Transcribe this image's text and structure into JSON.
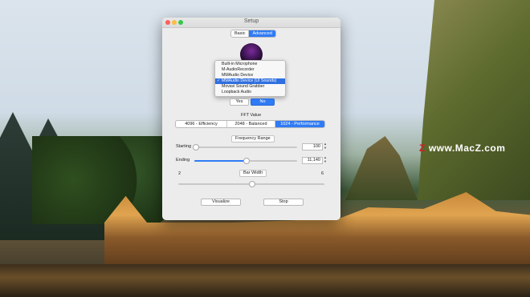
{
  "window": {
    "title": "Setup"
  },
  "tabs": [
    {
      "label": "Basic",
      "selected": false
    },
    {
      "label": "Advanced",
      "selected": true
    }
  ],
  "input_menu": {
    "items": [
      {
        "label": "Built-in Microphone",
        "selected": false
      },
      {
        "label": "M-AudioRecorder",
        "selected": false
      },
      {
        "label": "MMAudio Device",
        "selected": false
      },
      {
        "label": "MMAudio Device (UI Sounds)",
        "selected": true
      },
      {
        "label": "Movavi Sound Grabber",
        "selected": false
      },
      {
        "label": "Loopback Audio",
        "selected": false
      }
    ]
  },
  "yes_no": {
    "yes": "Yes",
    "no": "No",
    "selected": "No"
  },
  "fft": {
    "label": "FFT Value",
    "options": [
      {
        "label": "4096 - Efficiency",
        "selected": false
      },
      {
        "label": "2048 - Balanced",
        "selected": false
      },
      {
        "label": "1024 - Performance",
        "selected": true
      }
    ]
  },
  "frequency_range": {
    "label": "Frequency Range",
    "starting_label": "Starting",
    "starting_value": "100",
    "starting_fraction": 0.01,
    "ending_label": "Ending",
    "ending_value": "11,140",
    "ending_fraction": 0.5
  },
  "bar_width": {
    "label": "Bar Width",
    "min": "2",
    "max": "6",
    "fraction": 0.5
  },
  "actions": {
    "visualize": "Visualize",
    "stop": "Stop"
  },
  "watermark": {
    "text": "www.MacZ.com",
    "mark": "Z"
  },
  "colors": {
    "accent": "#2f7bf5",
    "menu_highlight": "#2f6fe0"
  }
}
